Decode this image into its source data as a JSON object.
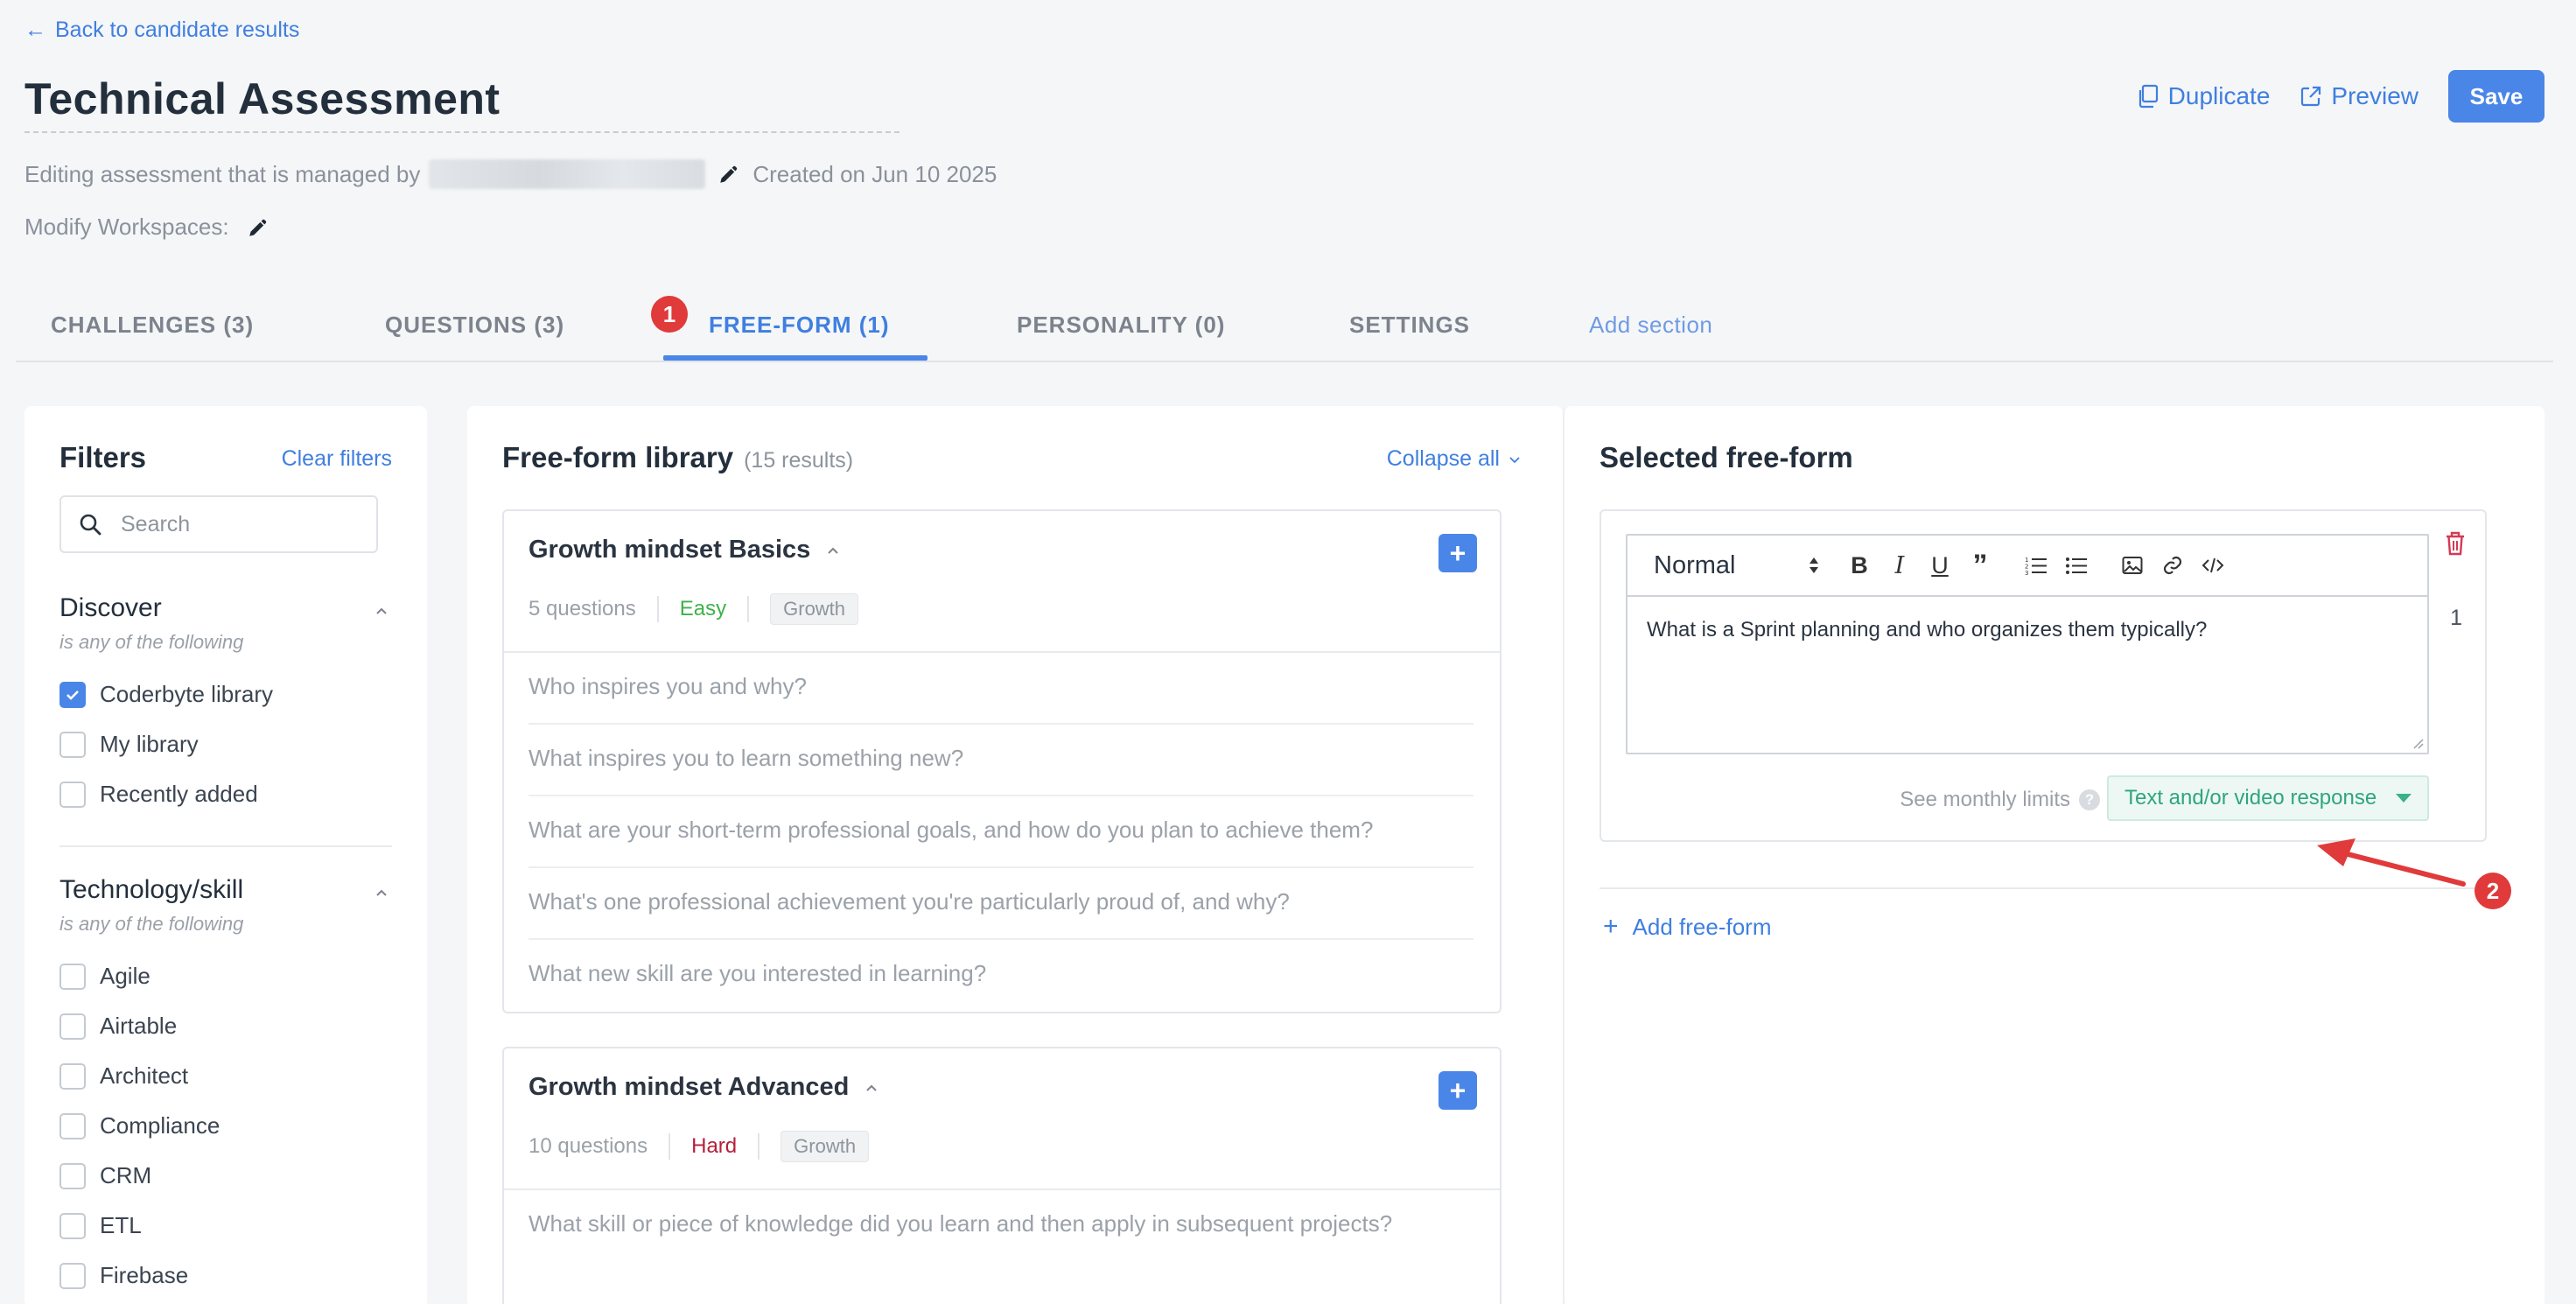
{
  "header": {
    "back_link": "Back to candidate results",
    "title": "Technical Assessment",
    "managed_by_prefix": "Editing assessment that is managed by",
    "created_on": "Created on Jun 10 2025",
    "modify_workspaces": "Modify Workspaces:",
    "actions": {
      "duplicate": "Duplicate",
      "preview": "Preview",
      "save": "Save"
    }
  },
  "tabs": [
    {
      "label": "CHALLENGES (3)"
    },
    {
      "label": "QUESTIONS (3)"
    },
    {
      "label": "FREE-FORM (1)"
    },
    {
      "label": "PERSONALITY (0)"
    },
    {
      "label": "SETTINGS"
    },
    {
      "label": "Add section"
    }
  ],
  "annotations": {
    "marker1": "1",
    "marker2": "2"
  },
  "filters": {
    "title": "Filters",
    "clear": "Clear filters",
    "search_placeholder": "Search",
    "groups": [
      {
        "title": "Discover",
        "subtitle": "is any of the following",
        "options": [
          {
            "label": "Coderbyte library",
            "checked": true
          },
          {
            "label": "My library",
            "checked": false
          },
          {
            "label": "Recently added",
            "checked": false
          }
        ]
      },
      {
        "title": "Technology/skill",
        "subtitle": "is any of the following",
        "options": [
          {
            "label": "Agile",
            "checked": false
          },
          {
            "label": "Airtable",
            "checked": false
          },
          {
            "label": "Architect",
            "checked": false
          },
          {
            "label": "Compliance",
            "checked": false
          },
          {
            "label": "CRM",
            "checked": false
          },
          {
            "label": "ETL",
            "checked": false
          },
          {
            "label": "Firebase",
            "checked": false
          }
        ]
      }
    ]
  },
  "library": {
    "title": "Free-form library",
    "count": "(15 results)",
    "collapse_all": "Collapse all",
    "cards": [
      {
        "title": "Growth mindset Basics",
        "count": "5 questions",
        "difficulty": "Easy",
        "tag": "Growth",
        "questions": [
          "Who inspires you and why?",
          "What inspires you to learn something new?",
          "What are your short-term professional goals, and how do you plan to achieve them?",
          "What's one professional achievement you're particularly proud of, and why?",
          "What new skill are you interested in learning?"
        ]
      },
      {
        "title": "Growth mindset Advanced",
        "count": "10 questions",
        "difficulty": "Hard",
        "tag": "Growth",
        "questions": [
          "What skill or piece of knowledge did you learn and then apply in subsequent projects?"
        ]
      }
    ]
  },
  "selected": {
    "title": "Selected free-form",
    "format": "Normal",
    "question_text": "What is a Sprint planning and who organizes them typically?",
    "number": "1",
    "monthly_limits": "See monthly limits",
    "help": "?",
    "response_type": "Text and/or video response",
    "add_freeform": "Add free-form"
  }
}
